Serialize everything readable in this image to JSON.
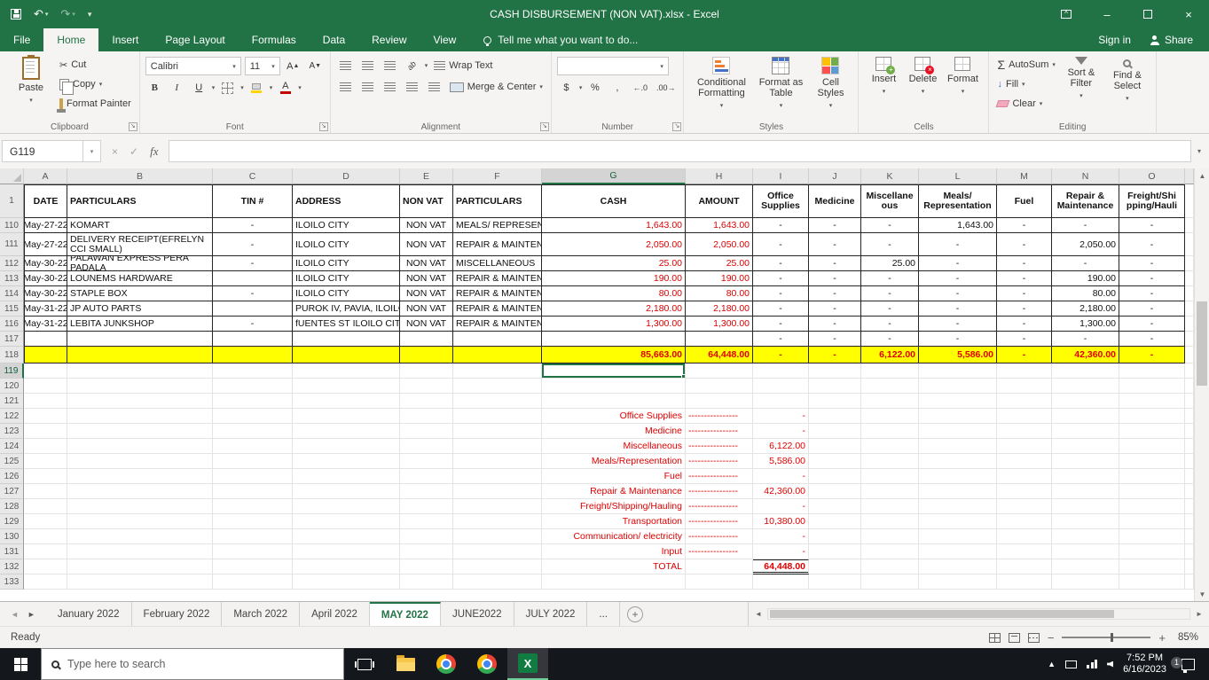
{
  "colors": {
    "excel_green": "#217346",
    "yellow_row": "#ffff00",
    "red_text": "#e00000"
  },
  "titlebar": {
    "title": "CASH DISBURSEMENT (NON VAT).xlsx - Excel"
  },
  "ribbon": {
    "tabs": [
      "File",
      "Home",
      "Insert",
      "Page Layout",
      "Formulas",
      "Data",
      "Review",
      "View"
    ],
    "active_tab": "Home",
    "tell_me": "Tell me what you want to do...",
    "sign_in": "Sign in",
    "share": "Share",
    "groups": {
      "clipboard": {
        "label": "Clipboard",
        "paste": "Paste",
        "cut": "Cut",
        "copy": "Copy",
        "format_painter": "Format Painter"
      },
      "font": {
        "label": "Font",
        "family": "Calibri",
        "size": "11"
      },
      "alignment": {
        "label": "Alignment",
        "wrap": "Wrap Text",
        "merge": "Merge & Center"
      },
      "number": {
        "label": "Number",
        "format": "General"
      },
      "styles": {
        "label": "Styles",
        "conditional": "Conditional Formatting",
        "format_table": "Format as Table",
        "cell_styles": "Cell Styles"
      },
      "cells": {
        "label": "Cells",
        "insert": "Insert",
        "delete": "Delete",
        "format": "Format"
      },
      "editing": {
        "label": "Editing",
        "autosum": "AutoSum",
        "fill": "Fill",
        "clear": "Clear",
        "sort": "Sort & Filter",
        "find": "Find & Select"
      }
    }
  },
  "formula_bar": {
    "name_box": "G119",
    "fx": "fx",
    "formula": ""
  },
  "grid": {
    "columns": [
      "A",
      "B",
      "C",
      "D",
      "E",
      "F",
      "G",
      "H",
      "I",
      "J",
      "K",
      "L",
      "M",
      "N",
      "O"
    ],
    "selected_column": "G",
    "selected_row": "119",
    "selected_cell": "G119",
    "rows": [
      {
        "num": "1",
        "type": "header",
        "cells": [
          "DATE",
          "PARTICULARS",
          "TIN #",
          "ADDRESS",
          "NON VAT",
          "PARTICULARS",
          "CASH",
          "AMOUNT",
          "Office\nSupplies",
          "Medicine",
          "Miscellane\nous",
          "Meals/\nRepresentation",
          "Fuel",
          "Repair &\nMaintenance",
          "Freight/Shi\npping/Hauli"
        ]
      },
      {
        "num": "110",
        "type": "data",
        "cells": [
          "May-27-22",
          "KOMART",
          "-",
          "ILOILO CITY",
          "NON VAT",
          "MEALS/ REPRESENTAT",
          "1,643.00",
          "1,643.00",
          "-",
          "-",
          "-",
          "1,643.00",
          "-",
          "-",
          "-"
        ]
      },
      {
        "num": "111",
        "type": "data",
        "cells": [
          "May-27-22",
          "DELIVERY RECEIPT(EFRELYN CCI SMALL)",
          "-",
          "ILOILO CITY",
          "NON VAT",
          "REPAIR & MAINTENAN",
          "2,050.00",
          "2,050.00",
          "-",
          "-",
          "-",
          "-",
          "-",
          "2,050.00",
          "-"
        ]
      },
      {
        "num": "112",
        "type": "data",
        "cells": [
          "May-30-22",
          "PALAWAN EXPRESS PERA PADALA",
          "-",
          "ILOILO CITY",
          "NON VAT",
          "MISCELLANEOUS",
          "25.00",
          "25.00",
          "-",
          "-",
          "25.00",
          "-",
          "-",
          "-",
          "-"
        ]
      },
      {
        "num": "113",
        "type": "data",
        "cells": [
          "May-30-22",
          "LOUNEMS HARDWARE",
          "",
          "ILOILO CITY",
          "NON VAT",
          "REPAIR & MAINTENAN",
          "190.00",
          "190.00",
          "-",
          "-",
          "-",
          "-",
          "-",
          "190.00",
          "-"
        ]
      },
      {
        "num": "114",
        "type": "data",
        "cells": [
          "May-30-22",
          "STAPLE BOX",
          "-",
          "ILOILO CITY",
          "NON VAT",
          "REPAIR & MAINTENA",
          "80.00",
          "80.00",
          "-",
          "-",
          "-",
          "-",
          "-",
          "80.00",
          "-"
        ]
      },
      {
        "num": "115",
        "type": "data",
        "cells": [
          "May-31-22",
          "JP AUTO PARTS",
          "",
          "PUROK IV, PAVIA, ILOILO",
          "NON VAT",
          "REPAIR & MAINTENAN",
          "2,180.00",
          "2,180.00",
          "-",
          "-",
          "-",
          "-",
          "-",
          "2,180.00",
          "-"
        ]
      },
      {
        "num": "116",
        "type": "data",
        "cells": [
          "May-31-22",
          "LEBITA JUNKSHOP",
          "-",
          "fUENTES ST ILOILO CITY",
          "NON VAT",
          "REPAIR & MAINTENAN",
          "1,300.00",
          "1,300.00",
          "-",
          "-",
          "-",
          "-",
          "-",
          "1,300.00",
          "-"
        ]
      },
      {
        "num": "117",
        "type": "data",
        "cells": [
          "",
          "",
          "",
          "",
          "",
          "",
          "",
          "",
          "-",
          "-",
          "-",
          "-",
          "-",
          "-",
          "-"
        ]
      },
      {
        "num": "118",
        "type": "total",
        "cells": [
          "",
          "",
          "",
          "",
          "",
          "",
          "85,663.00",
          "64,448.00",
          "-",
          "-",
          "6,122.00",
          "5,586.00",
          "-",
          "42,360.00",
          "-"
        ]
      },
      {
        "num": "119",
        "type": "plain",
        "cells": [
          "",
          "",
          "",
          "",
          "",
          "",
          "",
          "",
          "",
          "",
          "",
          "",
          "",
          "",
          ""
        ]
      },
      {
        "num": "120",
        "type": "plain",
        "cells": [
          "",
          "",
          "",
          "",
          "",
          "",
          "",
          "",
          "",
          "",
          "",
          "",
          "",
          "",
          ""
        ]
      },
      {
        "num": "121",
        "type": "plain",
        "cells": [
          "",
          "",
          "",
          "",
          "",
          "",
          "",
          "",
          "",
          "",
          "",
          "",
          "",
          "",
          ""
        ]
      },
      {
        "num": "122",
        "type": "summary",
        "cells": [
          "",
          "",
          "",
          "",
          "",
          "",
          "Office Supplies",
          "----------------",
          "-",
          "",
          "",
          "",
          "",
          "",
          ""
        ]
      },
      {
        "num": "123",
        "type": "summary",
        "cells": [
          "",
          "",
          "",
          "",
          "",
          "",
          "Medicine",
          "----------------",
          "-",
          "",
          "",
          "",
          "",
          "",
          ""
        ]
      },
      {
        "num": "124",
        "type": "summary",
        "cells": [
          "",
          "",
          "",
          "",
          "",
          "",
          "Miscellaneous",
          "----------------",
          "6,122.00",
          "",
          "",
          "",
          "",
          "",
          ""
        ]
      },
      {
        "num": "125",
        "type": "summary",
        "cells": [
          "",
          "",
          "",
          "",
          "",
          "",
          "Meals/Representation",
          "----------------",
          "5,586.00",
          "",
          "",
          "",
          "",
          "",
          ""
        ]
      },
      {
        "num": "126",
        "type": "summary",
        "cells": [
          "",
          "",
          "",
          "",
          "",
          "",
          "Fuel",
          "----------------",
          "-",
          "",
          "",
          "",
          "",
          "",
          ""
        ]
      },
      {
        "num": "127",
        "type": "summary",
        "cells": [
          "",
          "",
          "",
          "",
          "",
          "",
          "Repair & Maintenance",
          "----------------",
          "42,360.00",
          "",
          "",
          "",
          "",
          "",
          ""
        ]
      },
      {
        "num": "128",
        "type": "summary",
        "cells": [
          "",
          "",
          "",
          "",
          "",
          "",
          "Freight/Shipping/Hauling",
          "----------------",
          "-",
          "",
          "",
          "",
          "",
          "",
          ""
        ]
      },
      {
        "num": "129",
        "type": "summary",
        "cells": [
          "",
          "",
          "",
          "",
          "",
          "",
          "Transportation",
          "----------------",
          "10,380.00",
          "",
          "",
          "",
          "",
          "",
          ""
        ]
      },
      {
        "num": "130",
        "type": "summary",
        "cells": [
          "",
          "",
          "",
          "",
          "",
          "",
          "Communication/ electricity",
          "----------------",
          "-",
          "",
          "",
          "",
          "",
          "",
          ""
        ]
      },
      {
        "num": "131",
        "type": "summary",
        "cells": [
          "",
          "",
          "",
          "",
          "",
          "",
          "Input",
          "----------------",
          "-",
          "",
          "",
          "",
          "",
          "",
          ""
        ]
      },
      {
        "num": "132",
        "type": "grandtotal",
        "cells": [
          "",
          "",
          "",
          "",
          "",
          "",
          "TOTAL",
          "",
          "64,448.00",
          "",
          "",
          "",
          "",
          "",
          ""
        ]
      },
      {
        "num": "133",
        "type": "plain",
        "cells": [
          "",
          "",
          "",
          "",
          "",
          "",
          "",
          "",
          "",
          "",
          "",
          "",
          "",
          "",
          ""
        ]
      }
    ]
  },
  "sheet_tabs": {
    "items": [
      "January 2022",
      "February 2022",
      "March 2022",
      "April 2022",
      "MAY 2022",
      "JUNE2022",
      "JULY 2022"
    ],
    "active": "MAY 2022",
    "overflow": "..."
  },
  "status_bar": {
    "mode": "Ready",
    "zoom": "85%"
  },
  "taskbar": {
    "search_placeholder": "Type here to search",
    "clock_time": "7:52 PM",
    "clock_date": "6/16/2023",
    "notification_count": "1"
  }
}
